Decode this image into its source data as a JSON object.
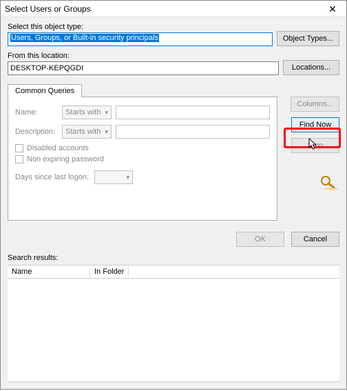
{
  "window": {
    "title": "Select Users or Groups",
    "close_glyph": "✕"
  },
  "object": {
    "label": "Select this object type:",
    "value": "Users, Groups, or Built-in security principals",
    "btn": "Object Types..."
  },
  "location": {
    "label": "From this location:",
    "value": "DESKTOP-KEPQGDI",
    "btn": "Locations..."
  },
  "tab": {
    "label": "Common Queries"
  },
  "queries": {
    "name_label": "Name:",
    "desc_label": "Description:",
    "starts_with": "Starts with",
    "disabled_cb": "Disabled accounts",
    "nonexpire_cb": "Non expiring password",
    "logon_label": "Days since last logon:"
  },
  "side": {
    "columns": "Columns...",
    "findnow": "Find Now",
    "stop": "Stop"
  },
  "bottom": {
    "ok": "OK",
    "cancel": "Cancel"
  },
  "results": {
    "label": "Search results:",
    "col_name": "Name",
    "col_folder": "In Folder"
  }
}
